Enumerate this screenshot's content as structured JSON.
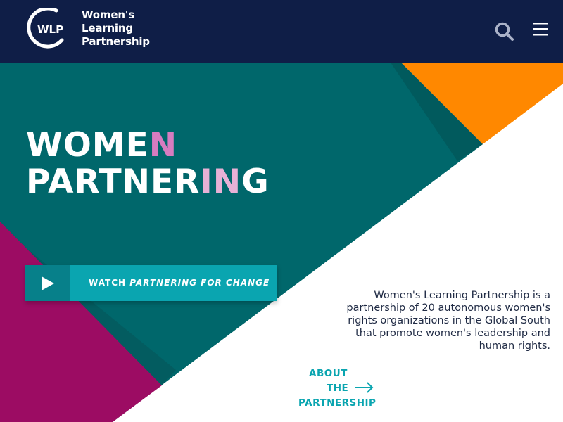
{
  "header": {
    "logo_badge": "WLP",
    "logo_lines": [
      "Women's",
      "Learning",
      "Partnership"
    ],
    "search_icon": "search-icon",
    "menu_icon": "hamburger-menu-icon"
  },
  "hero": {
    "headline_line1_a": "WOME",
    "headline_line1_b": "N",
    "headline_line2_a": "PARTNER",
    "headline_line2_b": "IN",
    "headline_line2_c": "G",
    "video_button": {
      "prefix": "WATCH ",
      "title": "PARTNERING FOR CHANGE",
      "icon": "play-icon"
    },
    "description": "Women's Learning Partnership is a partnership of 20 autonomous women's rights organizations in the Global South that promote women's leadership and human rights.",
    "about_link": {
      "line1": "ABOUT",
      "line2": "THE",
      "line3": "PARTNERSHIP",
      "icon": "arrow-right-icon"
    }
  },
  "colors": {
    "header_bg": "#0f1e47",
    "teal_dark": "#00676b",
    "teal_button": "#0aa5b0",
    "magenta": "#9c0c63",
    "orange": "#ff8800",
    "text_dark": "#1f2a44"
  }
}
